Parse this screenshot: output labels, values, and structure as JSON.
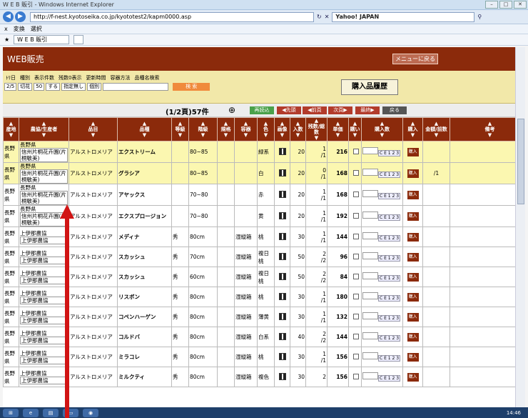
{
  "window": {
    "title": "W E B 販引 - Windows Internet Explorer"
  },
  "address": {
    "url": "http://f-nest.kyotoseika.co.jp/kyototest2/kapm0000.asp",
    "search": "Yahoo! JAPAN"
  },
  "command_bar": [
    "x",
    "変換",
    "選択"
  ],
  "favorites": {
    "tab": "W E B 販引"
  },
  "header": {
    "title": "WEB販売",
    "menu_button": "メニューに戻る"
  },
  "filters": {
    "labels": [
      "ﾄﾘ日",
      "種別",
      "表示件数",
      "残数0表示",
      "更新時間",
      "容器方法",
      "品種名検索"
    ],
    "values": [
      "2/5",
      "切花",
      "50",
      "する",
      "指定無し",
      "個別",
      ""
    ],
    "search_button": "検 索",
    "history_button": "購入品履歴"
  },
  "pager": {
    "count": "(1/2頁)57件",
    "buttons": [
      {
        "label": "再読込",
        "color": "#4aa14a"
      },
      {
        "label": "◀先頭",
        "color": "#b23b2b"
      },
      {
        "label": "◀前頁",
        "color": "#b23b2b"
      },
      {
        "label": "次頁▶",
        "color": "#b23b2b"
      },
      {
        "label": "最終▶",
        "color": "#b23b2b"
      },
      {
        "label": "戻る",
        "color": "#555555"
      }
    ]
  },
  "columns": [
    "産地",
    "農協/生産者",
    "品目",
    "品種",
    "等級",
    "階級",
    "規格",
    "容器",
    "色",
    "画像",
    "入数",
    "残数/総数",
    "単価",
    "購い",
    "購入数",
    "購入",
    "金額/前数",
    "備考"
  ],
  "rows": [
    {
      "area": "長野県",
      "p1": "長野県",
      "p2": "信州片桐花卉園(片桐敏美)",
      "item": "アルストロメリア",
      "variety": "エクストリーム",
      "grade": "",
      "size": "80~85",
      "spec": "",
      "box": "",
      "color": "緑系",
      "qty": "20",
      "rem": "1",
      "tot": "/1",
      "price": "216",
      "amount": "",
      "hl": true
    },
    {
      "area": "長野県",
      "p1": "長野県",
      "p2": "信州片桐花卉園(片桐敏美)",
      "item": "アルストロメリア",
      "variety": "グラシア",
      "grade": "",
      "size": "80~85",
      "spec": "",
      "box": "",
      "color": "白",
      "qty": "20",
      "rem": "0",
      "tot": "/1",
      "price": "168",
      "amount": "/1",
      "hl": true
    },
    {
      "area": "長野県",
      "p1": "長野県",
      "p2": "信州片桐花卉園(片桐敏美)",
      "item": "アルストロメリア",
      "variety": "アヤックス",
      "grade": "",
      "size": "70~80",
      "spec": "",
      "box": "",
      "color": "赤",
      "qty": "20",
      "rem": "1",
      "tot": "/1",
      "price": "168",
      "amount": "",
      "hl": false
    },
    {
      "area": "長野県",
      "p1": "長野県",
      "p2": "信州片桐花卉園(片桐敏美)",
      "item": "アルストロメリア",
      "variety": "エクスプロージョン",
      "grade": "",
      "size": "70~80",
      "spec": "",
      "box": "",
      "color": "黄",
      "qty": "20",
      "rem": "1",
      "tot": "/1",
      "price": "192",
      "amount": "",
      "hl": false
    },
    {
      "area": "長野県",
      "p1": "上伊那農協",
      "p2": "上伊那農協",
      "item": "アルストロメリア",
      "variety": "メディナ",
      "grade": "秀",
      "size": "80cm",
      "spec": "",
      "box": "湿縦箱",
      "color": "桃",
      "qty": "30",
      "rem": "1",
      "tot": "/1",
      "price": "144",
      "amount": "",
      "hl": false
    },
    {
      "area": "長野県",
      "p1": "上伊那農協",
      "p2": "上伊那農協",
      "item": "アルストロメリア",
      "variety": "スカッシュ",
      "grade": "秀",
      "size": "70cm",
      "spec": "",
      "box": "湿縦箱",
      "color": "複日桃",
      "qty": "50",
      "rem": "2",
      "tot": "/2",
      "price": "96",
      "amount": "",
      "hl": false
    },
    {
      "area": "長野県",
      "p1": "上伊那農協",
      "p2": "上伊那農協",
      "item": "アルストロメリア",
      "variety": "スカッシュ",
      "grade": "秀",
      "size": "60cm",
      "spec": "",
      "box": "湿縦箱",
      "color": "複日桃",
      "qty": "50",
      "rem": "2",
      "tot": "/2",
      "price": "84",
      "amount": "",
      "hl": false
    },
    {
      "area": "長野県",
      "p1": "上伊那農協",
      "p2": "上伊那農協",
      "item": "アルストロメリア",
      "variety": "リスボン",
      "grade": "秀",
      "size": "80cm",
      "spec": "",
      "box": "湿縦箱",
      "color": "桃",
      "qty": "30",
      "rem": "1",
      "tot": "/1",
      "price": "180",
      "amount": "",
      "hl": false
    },
    {
      "area": "長野県",
      "p1": "上伊那農協",
      "p2": "上伊那農協",
      "item": "アルストロメリア",
      "variety": "コペンハーゲン",
      "grade": "秀",
      "size": "80cm",
      "spec": "",
      "box": "湿縦箱",
      "color": "薄黄",
      "qty": "30",
      "rem": "1",
      "tot": "/1",
      "price": "132",
      "amount": "",
      "hl": false
    },
    {
      "area": "長野県",
      "p1": "上伊那農協",
      "p2": "上伊那農協",
      "item": "アルストロメリア",
      "variety": "コルドバ",
      "grade": "秀",
      "size": "80cm",
      "spec": "",
      "box": "湿縦箱",
      "color": "白系",
      "qty": "40",
      "rem": "2",
      "tot": "/2",
      "price": "144",
      "amount": "",
      "hl": false
    },
    {
      "area": "長野県",
      "p1": "上伊那農協",
      "p2": "上伊那農協",
      "item": "アルストロメリア",
      "variety": "ミラコレ",
      "grade": "秀",
      "size": "80cm",
      "spec": "",
      "box": "湿縦箱",
      "color": "桃",
      "qty": "30",
      "rem": "1",
      "tot": "/1",
      "price": "156",
      "amount": "",
      "hl": false
    },
    {
      "area": "長野県",
      "p1": "上伊那農協",
      "p2": "上伊那農協",
      "item": "アルストロメリア",
      "variety": "ミルクティ",
      "grade": "秀",
      "size": "80cm",
      "spec": "",
      "box": "湿縦箱",
      "color": "複色",
      "qty": "30",
      "rem": "2",
      "tot": "",
      "price": "156",
      "amount": "",
      "hl": false
    }
  ],
  "row_widgets": {
    "keys": "C E 1 2 3",
    "buy": "購入"
  },
  "taskbar": {
    "clock": "14:46"
  }
}
